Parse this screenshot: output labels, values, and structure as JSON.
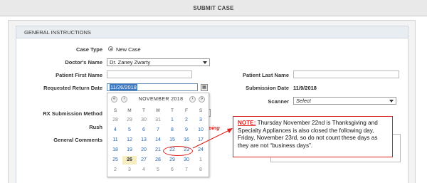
{
  "page_title": "SUBMIT CASE",
  "section_title": "GENERAL INSTRUCTIONS",
  "form": {
    "case_type": {
      "label": "Case Type",
      "value": "New Case"
    },
    "doctor": {
      "label": "Doctor's Name",
      "value": "Dr. Zaney Zwarty"
    },
    "first_name": {
      "label": "Patient First Name",
      "value": ""
    },
    "last_name": {
      "label": "Patient Last Name",
      "value": ""
    },
    "return_date": {
      "label": "Requested Return Date",
      "value": "11/26/2018"
    },
    "submission_date": {
      "label": "Submission Date",
      "value": "11/9/2018"
    },
    "scanner": {
      "label": "Scanner",
      "value": "Select"
    },
    "rx_method": {
      "label": "RX Submission Method"
    },
    "rush": {
      "label": "Rush",
      "partial_text": "ping"
    },
    "general_comments": {
      "label": "General Comments"
    }
  },
  "calendar": {
    "title": "NOVEMBER 2018",
    "nav": {
      "prev_year": "«",
      "prev_month": "‹",
      "next_month": "›",
      "next_year": "»"
    },
    "weekdays": [
      "S",
      "M",
      "T",
      "W",
      "T",
      "F",
      "S"
    ],
    "weeks": [
      [
        "28",
        "29",
        "30",
        "31",
        "1",
        "2",
        "3"
      ],
      [
        "4",
        "5",
        "6",
        "7",
        "8",
        "9",
        "10"
      ],
      [
        "11",
        "12",
        "13",
        "14",
        "15",
        "16",
        "17"
      ],
      [
        "18",
        "19",
        "20",
        "21",
        "22",
        "23",
        "24"
      ],
      [
        "25",
        "26",
        "27",
        "28",
        "29",
        "30",
        "1"
      ],
      [
        "2",
        "3",
        "4",
        "5",
        "6",
        "7",
        "8"
      ]
    ],
    "muted_start": 4,
    "muted_end_from": "5:6",
    "today": "26",
    "circled": [
      "22",
      "23"
    ]
  },
  "note": {
    "label": "NOTE:",
    "text": " Thursday November 22nd is Thanksgiving and Specialty Appliances is also closed the following day, Friday, November 23rd, so do not count these days as they are not “business days”."
  }
}
